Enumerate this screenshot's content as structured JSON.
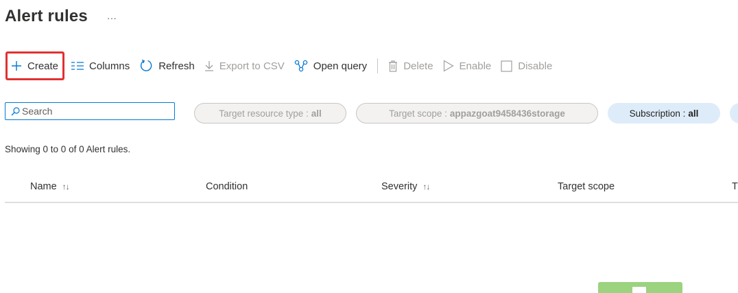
{
  "header": {
    "title": "Alert rules",
    "more": "···"
  },
  "toolbar": {
    "create": "Create",
    "columns": "Columns",
    "refresh": "Refresh",
    "export": "Export to CSV",
    "open_query": "Open query",
    "delete": "Delete",
    "enable": "Enable",
    "disable": "Disable"
  },
  "search": {
    "placeholder": "Search",
    "value": ""
  },
  "filters": {
    "resource_type_label": "Target resource type :",
    "resource_type_value": "all",
    "scope_label": "Target scope :",
    "scope_value": "appazgoat9458436storage",
    "subscription_label": "Subscription :",
    "subscription_value": "all"
  },
  "summary": "Showing 0 to 0 of 0 Alert rules.",
  "table": {
    "columns": [
      "Name",
      "Condition",
      "Severity",
      "Target scope",
      "T"
    ],
    "sort_glyph": "↑↓"
  },
  "colors": {
    "accent": "#0078d4",
    "highlight_border": "#e03131",
    "pill_active": "#deecf9",
    "status_green": "#9bd37f"
  }
}
